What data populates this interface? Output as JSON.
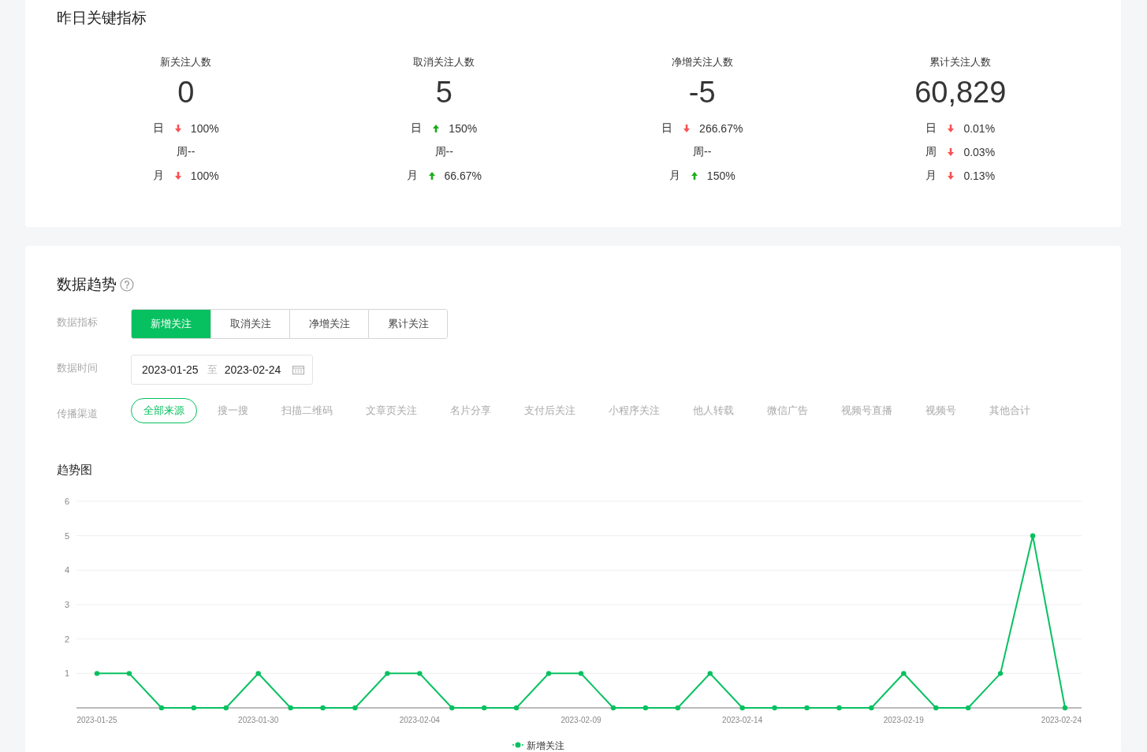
{
  "key_metrics": {
    "title": "昨日关键指标",
    "metrics": [
      {
        "label": "新关注人数",
        "value": "0",
        "changes": [
          {
            "kind": "down",
            "period": "日",
            "value": "100%"
          },
          {
            "kind": "flat",
            "period": "周",
            "value": "--"
          },
          {
            "kind": "down",
            "period": "月",
            "value": "100%"
          }
        ]
      },
      {
        "label": "取消关注人数",
        "value": "5",
        "changes": [
          {
            "kind": "up",
            "period": "日",
            "value": "150%"
          },
          {
            "kind": "flat",
            "period": "周",
            "value": "--"
          },
          {
            "kind": "up",
            "period": "月",
            "value": "66.67%"
          }
        ]
      },
      {
        "label": "净增关注人数",
        "value": "-5",
        "changes": [
          {
            "kind": "down",
            "period": "日",
            "value": "266.67%"
          },
          {
            "kind": "flat",
            "period": "周",
            "value": "--"
          },
          {
            "kind": "up",
            "period": "月",
            "value": "150%"
          }
        ]
      },
      {
        "label": "累计关注人数",
        "value": "60,829",
        "changes": [
          {
            "kind": "down",
            "period": "日",
            "value": "0.01%"
          },
          {
            "kind": "down",
            "period": "周",
            "value": "0.03%"
          },
          {
            "kind": "down",
            "period": "月",
            "value": "0.13%"
          }
        ]
      }
    ]
  },
  "trend": {
    "title": "数据趋势",
    "metric_label": "数据指标",
    "metric_tabs": [
      {
        "label": "新增关注",
        "selected": true
      },
      {
        "label": "取消关注",
        "selected": false
      },
      {
        "label": "净增关注",
        "selected": false
      },
      {
        "label": "累计关注",
        "selected": false
      }
    ],
    "date_label": "数据时间",
    "date_range": {
      "start": "2023-01-25",
      "separator": "至",
      "end": "2023-02-24"
    },
    "channel_label": "传播渠道",
    "channels": [
      {
        "label": "全部来源",
        "selected": true
      },
      {
        "label": "搜一搜",
        "selected": false
      },
      {
        "label": "扫描二维码",
        "selected": false
      },
      {
        "label": "文章页关注",
        "selected": false
      },
      {
        "label": "名片分享",
        "selected": false
      },
      {
        "label": "支付后关注",
        "selected": false
      },
      {
        "label": "小程序关注",
        "selected": false
      },
      {
        "label": "他人转载",
        "selected": false
      },
      {
        "label": "微信广告",
        "selected": false
      },
      {
        "label": "视频号直播",
        "selected": false
      },
      {
        "label": "视频号",
        "selected": false
      },
      {
        "label": "其他合计",
        "selected": false
      }
    ],
    "chart_title": "趋势图",
    "chart_data": {
      "type": "line",
      "grid": true,
      "categories": [
        "2023-01-25",
        null,
        null,
        null,
        null,
        "2023-01-30",
        null,
        null,
        null,
        null,
        "2023-02-04",
        null,
        null,
        null,
        null,
        "2023-02-09",
        null,
        null,
        null,
        null,
        "2023-02-14",
        null,
        null,
        null,
        null,
        "2023-02-19",
        null,
        null,
        null,
        null,
        "2023-02-24"
      ],
      "ylim": [
        0,
        6
      ],
      "yticks": [
        1,
        2,
        3,
        4,
        5,
        6
      ],
      "series": [
        {
          "name": "新增关注",
          "color": "#07c160",
          "marker": true,
          "values": [
            1,
            1,
            0,
            0,
            0,
            1,
            0,
            0,
            0,
            1,
            1,
            0,
            0,
            0,
            1,
            1,
            0,
            0,
            0,
            1,
            0,
            0,
            0,
            0,
            0,
            1,
            0,
            0,
            1,
            5,
            0
          ]
        }
      ]
    }
  }
}
